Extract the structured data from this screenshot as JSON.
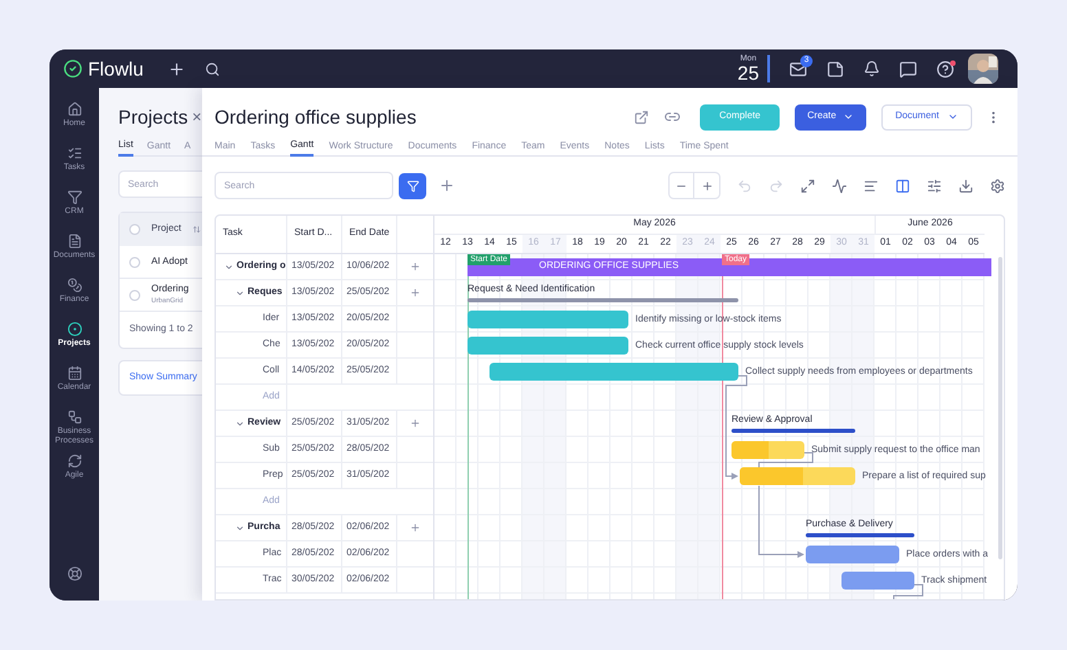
{
  "app": {
    "name": "Flowlu"
  },
  "top_bar": {
    "day_name": "Mon",
    "day_number": "25",
    "mail_badge": "3",
    "help_alert": true
  },
  "sidebar": {
    "items": [
      {
        "label": "Home",
        "selected": false
      },
      {
        "label": "Tasks",
        "selected": false
      },
      {
        "label": "CRM",
        "selected": false
      },
      {
        "label": "Documents",
        "selected": false
      },
      {
        "label": "Finance",
        "selected": false
      },
      {
        "label": "Projects",
        "selected": true
      },
      {
        "label": "Calendar",
        "selected": false
      },
      {
        "label": "Business Processes",
        "selected": false
      },
      {
        "label": "Agile",
        "selected": false
      }
    ]
  },
  "projects_panel": {
    "title": "Projects",
    "close": "×",
    "tabs": [
      {
        "label": "List",
        "selected": true
      },
      {
        "label": "Gantt",
        "selected": false
      },
      {
        "label": "A",
        "selected": false
      }
    ],
    "search": {
      "placeholder": "Search"
    },
    "column": "Project",
    "all_checked": false,
    "rows": [
      {
        "name": "AI Adopt",
        "checked": false
      },
      {
        "name": "Ordering",
        "subtitle": "UrbanGrid",
        "checked": false
      }
    ],
    "footer": "Showing 1 to 2",
    "summary_link": "Show Summary"
  },
  "project": {
    "title": "Ordering office supplies",
    "tabs": [
      {
        "label": "Main",
        "selected": false
      },
      {
        "label": "Tasks",
        "selected": false
      },
      {
        "label": "Gantt",
        "selected": true
      },
      {
        "label": "Work Structure",
        "selected": false
      },
      {
        "label": "Documents",
        "selected": false
      },
      {
        "label": "Finance",
        "selected": false
      },
      {
        "label": "Team",
        "selected": false
      },
      {
        "label": "Events",
        "selected": false
      },
      {
        "label": "Notes",
        "selected": false
      },
      {
        "label": "Lists",
        "selected": false
      },
      {
        "label": "Time Spent",
        "selected": false
      }
    ],
    "complete": "Complete",
    "create": "Create",
    "document": "Document"
  },
  "toolbar": {
    "search": {
      "placeholder": "Search"
    },
    "filter_active": true,
    "undo_disabled": true,
    "redo_disabled": true,
    "columns_view_active": true
  },
  "gantt": {
    "columns": [
      "Task",
      "Start D...",
      "End Date"
    ],
    "months": [
      "May 2026",
      "June 2026"
    ],
    "days": [
      {
        "label": "12",
        "weekend": false
      },
      {
        "label": "13",
        "weekend": false
      },
      {
        "label": "14",
        "weekend": false
      },
      {
        "label": "15",
        "weekend": false
      },
      {
        "label": "16",
        "weekend": true
      },
      {
        "label": "17",
        "weekend": true
      },
      {
        "label": "18",
        "weekend": false
      },
      {
        "label": "19",
        "weekend": false
      },
      {
        "label": "20",
        "weekend": false
      },
      {
        "label": "21",
        "weekend": false
      },
      {
        "label": "22",
        "weekend": false
      },
      {
        "label": "23",
        "weekend": true
      },
      {
        "label": "24",
        "weekend": true
      },
      {
        "label": "25",
        "weekend": false
      },
      {
        "label": "26",
        "weekend": false
      },
      {
        "label": "27",
        "weekend": false
      },
      {
        "label": "28",
        "weekend": false
      },
      {
        "label": "29",
        "weekend": false
      },
      {
        "label": "30",
        "weekend": true
      },
      {
        "label": "31",
        "weekend": true
      },
      {
        "label": "01",
        "weekend": false
      },
      {
        "label": "02",
        "weekend": false
      },
      {
        "label": "03",
        "weekend": false
      },
      {
        "label": "04",
        "weekend": false
      },
      {
        "label": "05",
        "weekend": false
      }
    ],
    "start_marker": "Start Date",
    "today_marker": "Today",
    "rows": [
      {
        "kind": "summary",
        "task": "Ordering o",
        "start": "13/05/202",
        "end": "10/06/202",
        "expanded": true,
        "bar_label": "ORDERING OFFICE SUPPLIES",
        "color": "#8b5cf6"
      },
      {
        "kind": "group",
        "task": "Reques",
        "start": "13/05/202",
        "end": "25/05/202",
        "expanded": true,
        "bar_label": "Request & Need Identification",
        "color": "#8e93aa"
      },
      {
        "kind": "task",
        "task": "Ider",
        "start": "13/05/202",
        "end": "20/05/202",
        "bar_label": "Identify missing or low-stock items",
        "color": "#35c4cf"
      },
      {
        "kind": "task",
        "task": "Che",
        "start": "13/05/202",
        "end": "20/05/202",
        "bar_label": "Check current office supply stock levels",
        "color": "#35c4cf"
      },
      {
        "kind": "task",
        "task": "Coll",
        "start": "14/05/202",
        "end": "25/05/202",
        "bar_label": "Collect supply needs from employees or departments",
        "color": "#35c4cf"
      },
      {
        "kind": "add",
        "task": "Add"
      },
      {
        "kind": "group",
        "task": "Review",
        "start": "25/05/202",
        "end": "31/05/202",
        "expanded": true,
        "bar_label": "Review & Approval",
        "color": "#2d4fc9"
      },
      {
        "kind": "task",
        "task": "Sub",
        "start": "25/05/202",
        "end": "28/05/202",
        "bar_label": "Submit supply request to the office man",
        "color": "#fcd95a",
        "level": 0.5
      },
      {
        "kind": "task",
        "task": "Prep",
        "start": "25/05/202",
        "end": "31/05/202",
        "bar_label": "Prepare a list of required sup",
        "color": "#fcd95a",
        "level": 0.55
      },
      {
        "kind": "add",
        "task": "Add"
      },
      {
        "kind": "group",
        "task": "Purcha",
        "start": "28/05/202",
        "end": "02/06/202",
        "expanded": true,
        "bar_label": "Purchase & Delivery",
        "color": "#2d4fc9"
      },
      {
        "kind": "task",
        "task": "Plac",
        "start": "28/05/202",
        "end": "02/06/202",
        "bar_label": "Place orders with a",
        "color": "#7b9cf0"
      },
      {
        "kind": "task",
        "task": "Trac",
        "start": "30/05/202",
        "end": "02/06/202",
        "bar_label": "Track shipment",
        "color": "#7b9cf0"
      }
    ]
  }
}
